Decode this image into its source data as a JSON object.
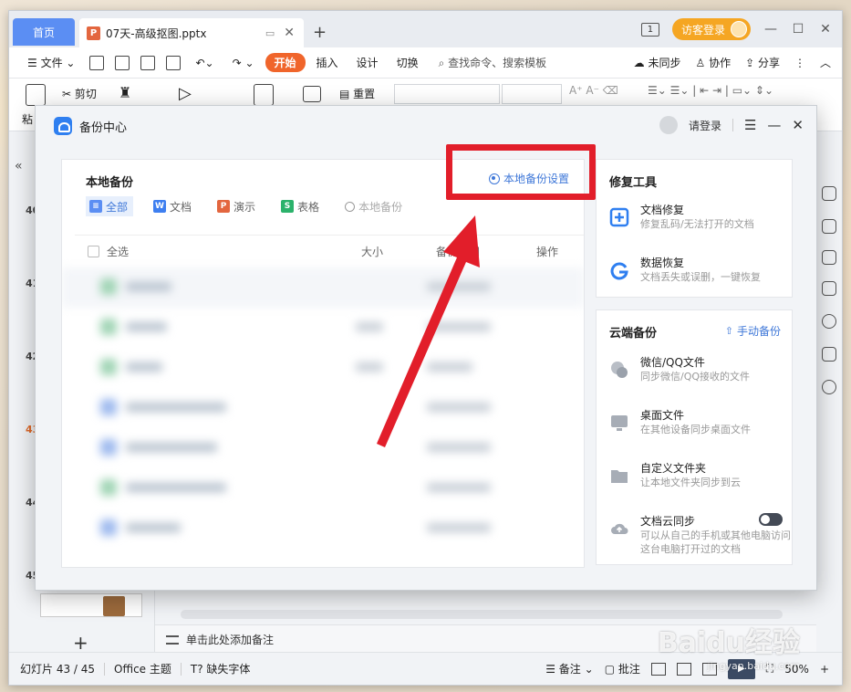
{
  "app": {
    "home_tab": "首页",
    "doc_tab": "07天-高级抠图.pptx",
    "doc_icon": "P",
    "guest_login": "访客登录",
    "tab_count": "1"
  },
  "menu": {
    "file": "文件",
    "items": [
      "开始",
      "插入",
      "设计",
      "切换"
    ],
    "search": "查找命令、搜索模板",
    "unsync": "未同步",
    "collab": "协作",
    "share": "分享"
  },
  "toolbar": {
    "paste": "粘",
    "cut": "剪切",
    "reset": "重置"
  },
  "slides": {
    "numbers": [
      "40",
      "41",
      "42",
      "43",
      "44",
      "45"
    ],
    "current": "43"
  },
  "notes": "单击此处添加备注",
  "status": {
    "slide_info": "幻灯片 43 / 45",
    "theme": "Office 主题",
    "missing_font": "缺失字体",
    "notes": "备注",
    "comments": "批注",
    "zoom": "50%"
  },
  "dialog": {
    "title": "备份中心",
    "login": "请登录",
    "local": {
      "title": "本地备份",
      "settings": "本地备份设置",
      "filters": [
        {
          "label": "全部",
          "icon": "≡",
          "color": "#5b8ef3"
        },
        {
          "label": "文档",
          "icon": "W",
          "color": "#3e7ff0"
        },
        {
          "label": "演示",
          "icon": "P",
          "color": "#e3663f"
        },
        {
          "label": "表格",
          "icon": "S",
          "color": "#2bb26b"
        }
      ],
      "search_placeholder": "本地备份",
      "columns": {
        "select_all": "全选",
        "size": "大小",
        "date": "备份时间",
        "op": "操作"
      }
    },
    "repair": {
      "title": "修复工具",
      "items": [
        {
          "title": "文档修复",
          "desc": "修复乱码/无法打开的文档"
        },
        {
          "title": "数据恢复",
          "desc": "文档丢失或误删，一键恢复"
        }
      ]
    },
    "cloud": {
      "title": "云端备份",
      "manual": "手动备份",
      "items": [
        {
          "title": "微信/QQ文件",
          "desc": "同步微信/QQ接收的文件"
        },
        {
          "title": "桌面文件",
          "desc": "在其他设备同步桌面文件"
        },
        {
          "title": "自定义文件夹",
          "desc": "让本地文件夹同步到云"
        },
        {
          "title": "文档云同步",
          "desc": "可以从自己的手机或其他电脑访问这台电脑打开过的文档",
          "toggle_on": false
        }
      ]
    }
  },
  "watermark": {
    "main": "Baidu经验",
    "sub": "jingyan.baidu.com"
  }
}
